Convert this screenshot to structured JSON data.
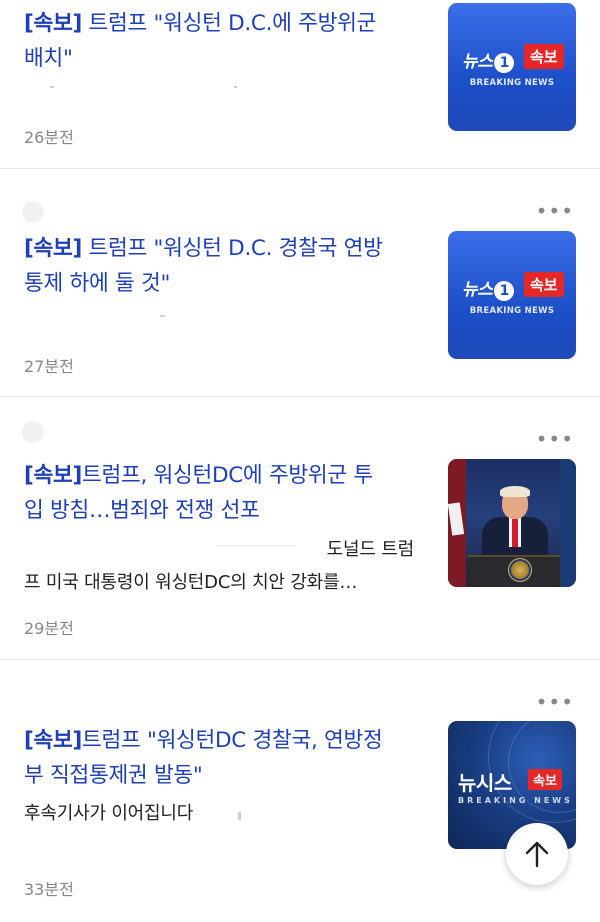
{
  "articles": [
    {
      "tag": "[속보]",
      "title_line1": " 트럼프 \"워싱턴 D.C.에 주방위군",
      "title_line2": "배치\"",
      "time": "26분전",
      "thumb": {
        "type": "news1",
        "logo": "뉴스",
        "logo_one": "1",
        "badge": "속보",
        "sub": "BREAKING NEWS"
      }
    },
    {
      "tag": "[속보]",
      "title_line1": " 트럼프 \"워싱턴 D.C. 경찰국 연방",
      "title_line2": "통제 하에 둘 것\"",
      "time": "27분전",
      "more": "•••",
      "thumb": {
        "type": "news1",
        "logo": "뉴스",
        "logo_one": "1",
        "badge": "속보",
        "sub": "BREAKING NEWS"
      }
    },
    {
      "tag": "[속보]",
      "title_line1": "트럼프, 워싱턴DC에 주방위군 투",
      "title_line2": "입 방침…범죄와 전쟁 선포",
      "summary_line1": "도널드 트럼",
      "summary_line2": "프 미국 대통령이 워싱턴DC의 치안 강화를…",
      "time": "29분전",
      "more": "•••",
      "thumb": {
        "type": "photo",
        "icon": "trump-press-photo"
      }
    },
    {
      "tag": "[속보]",
      "title_line1": "트럼프 \"워싱턴DC 경찰국, 연방정",
      "title_line2": "부 직접통제권 발동\"",
      "summary_line1": "후속기사가 이어집니다",
      "time": "33분전",
      "more": "•••",
      "thumb": {
        "type": "newsis",
        "logo": "뉴시스",
        "badge": "속보",
        "sub": "BREAKING NEWS"
      }
    }
  ],
  "scroll_top": {
    "icon": "arrow-up-icon"
  }
}
